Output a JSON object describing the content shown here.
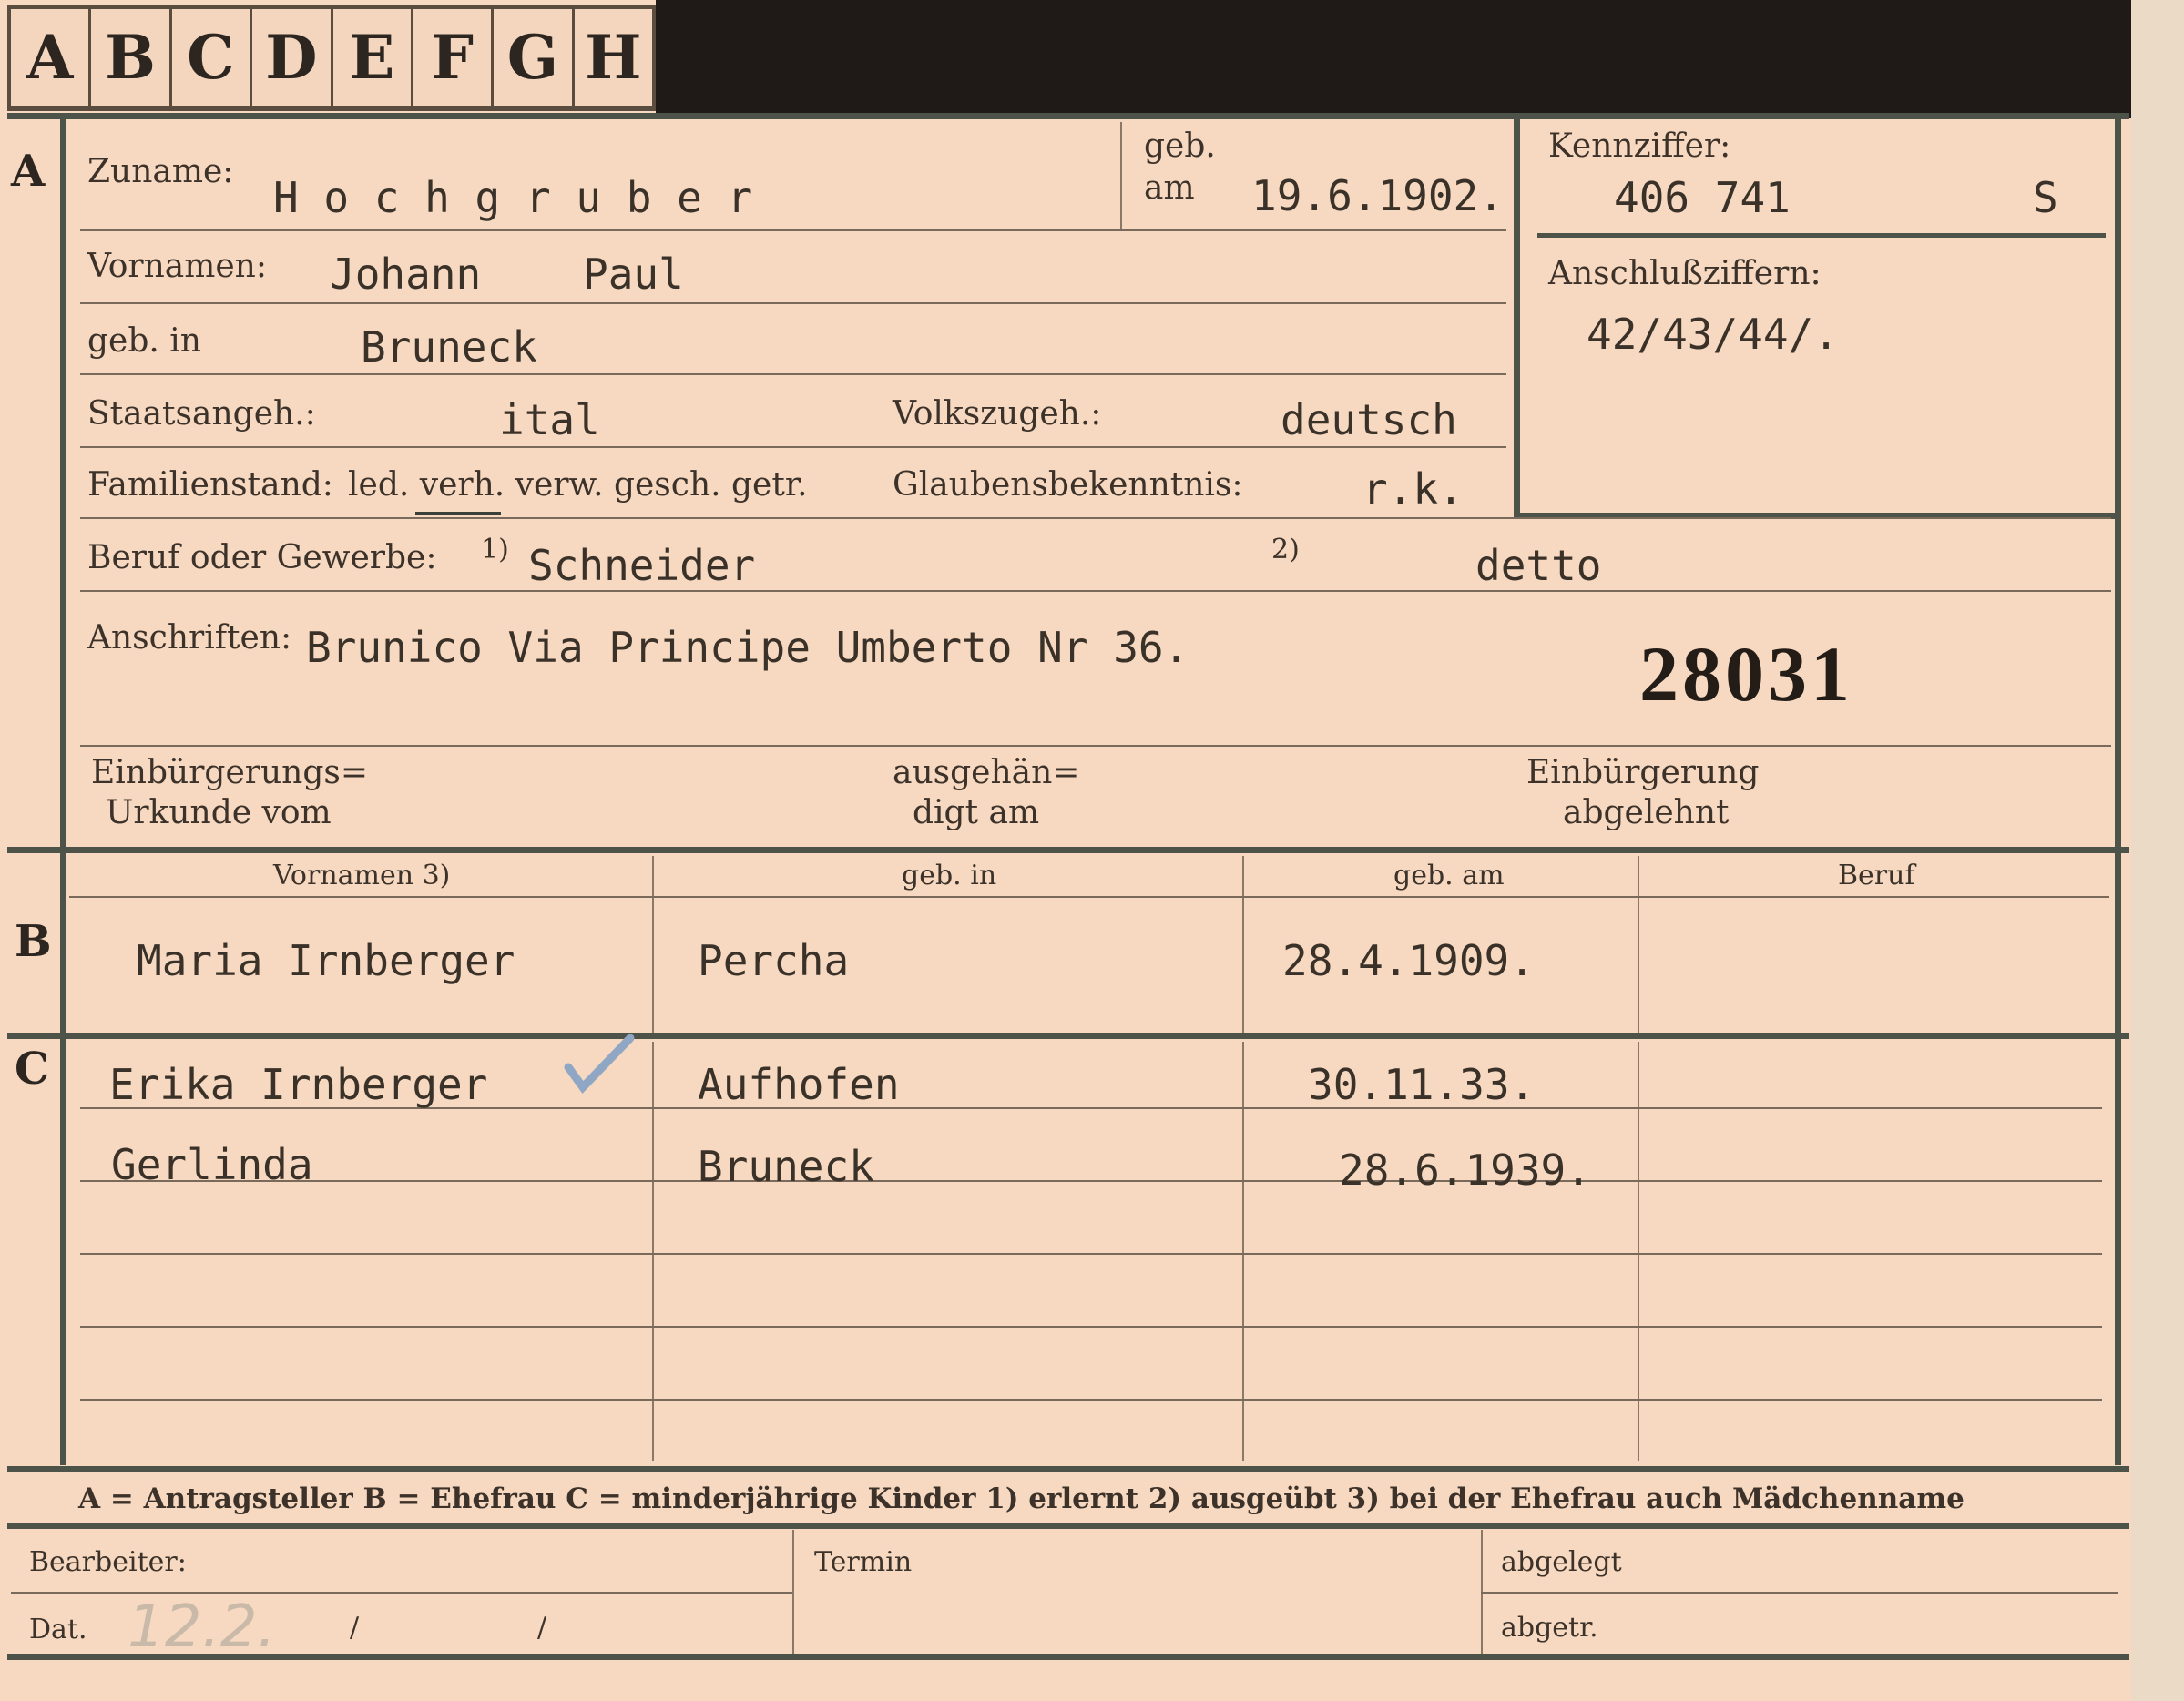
{
  "tabs": [
    "A",
    "B",
    "C",
    "D",
    "E",
    "F",
    "G",
    "H"
  ],
  "section_a": {
    "marker": "A",
    "surname_label": "Zuname:",
    "surname": "H o c h g r u b e r",
    "born_label_1": "geb.",
    "born_label_2": "am",
    "born_date": "19.6.1902.",
    "ident_label": "Kennziffer:",
    "ident_value": "406 741",
    "ident_suffix": "S",
    "addon_label": "Anschlußziffern:",
    "addon_value": "42/43/44/.",
    "given_label": "Vornamen:",
    "given_1": "Johann",
    "given_2": "Paul",
    "birthplace_label": "geb. in",
    "birthplace": "Bruneck",
    "citizenship_label": "Staatsangeh.:",
    "citizenship": "ital",
    "ethnicity_label": "Volkszugeh.:",
    "ethnicity": "deutsch",
    "family_label": "Familienstand:",
    "family_options": "led. verh. verw. gesch. getr.",
    "religion_label": "Glaubensbekenntnis:",
    "religion": "r.k.",
    "job_label": "Beruf oder Gewerbe:",
    "job_note1": "1)",
    "job_learned": "Schneider",
    "job_note2": "2)",
    "job_practiced": "detto",
    "address_label": "Anschriften:",
    "address": "Brunico Via Principe Umberto Nr 36.",
    "stamp_number": "28031",
    "naturalization_label_1": "Einbürgerungs=",
    "naturalization_label_2": "Urkunde vom",
    "handed_label_1": "ausgehän=",
    "handed_label_2": "digt am",
    "rejected_label_1": "Einbürgerung",
    "rejected_label_2": "abgelehnt"
  },
  "section_b": {
    "marker": "B",
    "columns": [
      "Vornamen 3)",
      "geb. in",
      "geb. am",
      "Beruf"
    ],
    "row": {
      "name": "Maria Irnberger",
      "place": "Percha",
      "date": "28.4.1909.",
      "job": ""
    }
  },
  "section_c": {
    "marker": "C",
    "rows": [
      {
        "name": "Erika Irnberger",
        "place": "Aufhofen",
        "date": "30.11.33.",
        "job": ""
      },
      {
        "name": "Gerlinda",
        "place": "Bruneck",
        "date": "28.6.1939.",
        "job": ""
      }
    ]
  },
  "legend": "A = Antragsteller   B = Ehefrau   C = minderjährige Kinder   1) erlernt   2) ausgeübt   3) bei der Ehefrau auch Mädchenname",
  "footer": {
    "clerk_label": "Bearbeiter:",
    "date_label": "Dat.",
    "date_value": "12.2.",
    "slash_1": "/",
    "slash_2": "/",
    "deadline_label": "Termin",
    "filed_label": "abgelegt",
    "removed_label": "abgetr."
  },
  "colors": {
    "card": "#f6d9c0",
    "ink": "#3b3128",
    "frame": "#4d5349",
    "check": "#8fa6c4"
  }
}
